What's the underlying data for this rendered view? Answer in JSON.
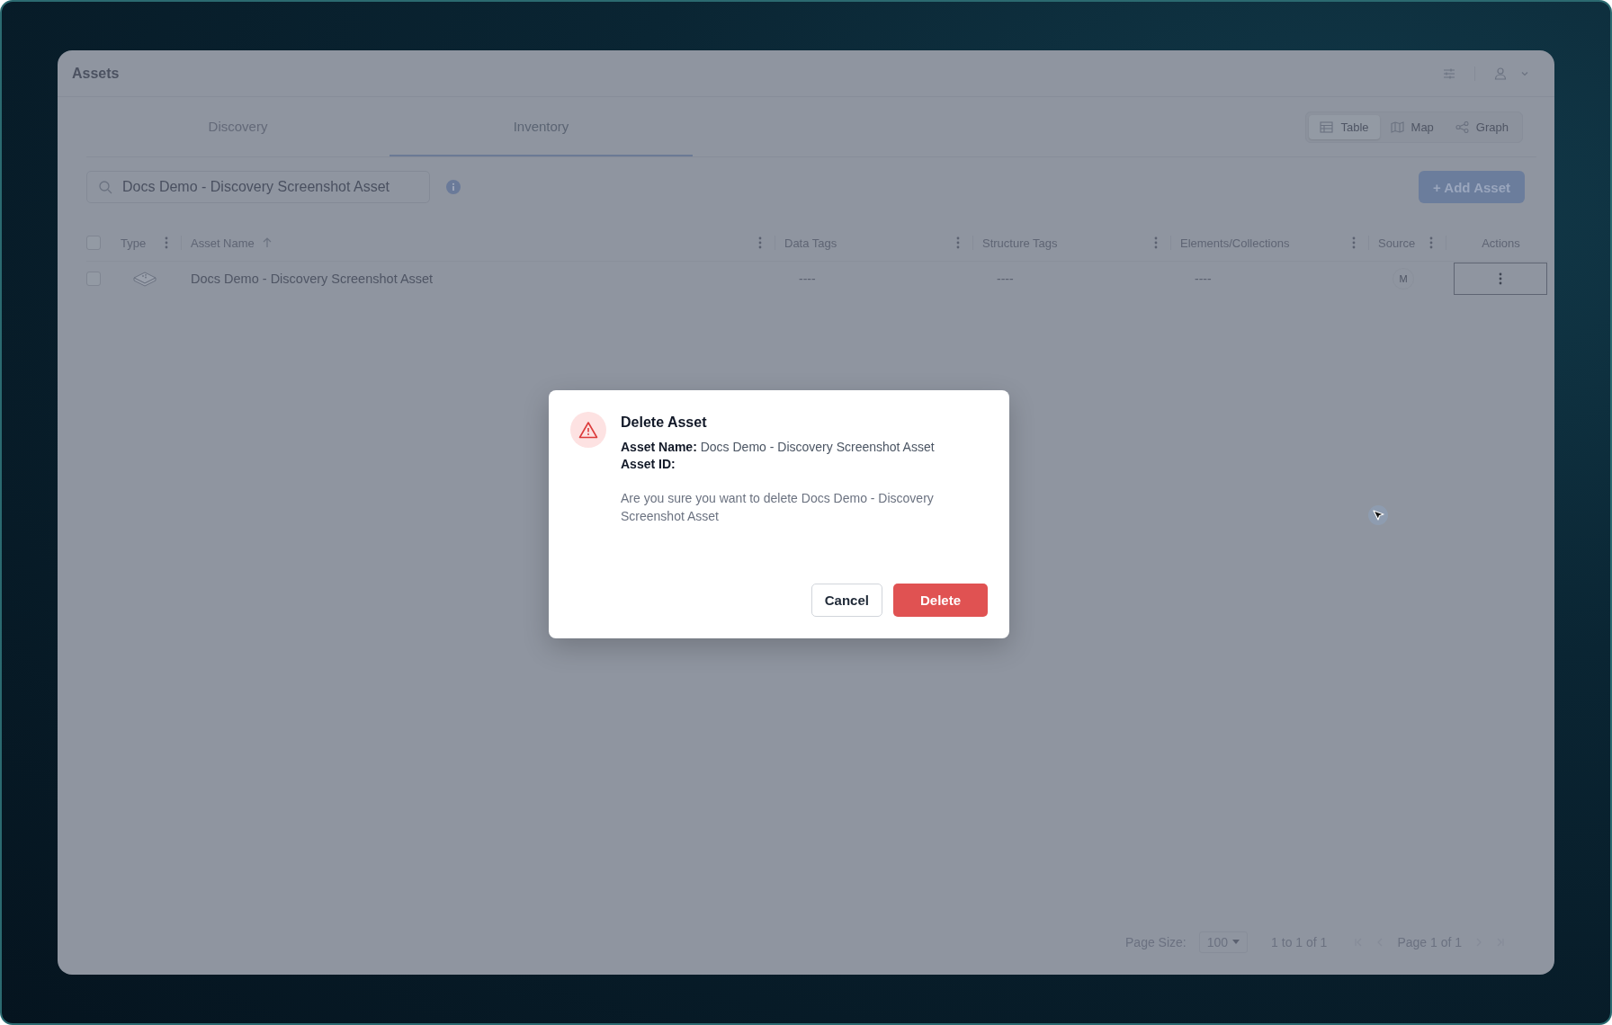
{
  "header": {
    "title": "Assets"
  },
  "tabs": [
    {
      "label": "Discovery",
      "selected": false
    },
    {
      "label": "Inventory",
      "selected": true
    }
  ],
  "view_switcher": [
    {
      "label": "Table",
      "kind": "table",
      "selected": true
    },
    {
      "label": "Map",
      "kind": "map",
      "selected": false
    },
    {
      "label": "Graph",
      "kind": "graph",
      "selected": false
    }
  ],
  "search": {
    "value": "Docs Demo - Discovery Screenshot Asset"
  },
  "add_button": "+ Add Asset",
  "table": {
    "select_all_checked": false,
    "columns": [
      {
        "label": "Type",
        "menu": true,
        "sorted": false
      },
      {
        "label": "Asset Name",
        "menu": true,
        "sorted": true
      },
      {
        "label": "Data Tags",
        "menu": true,
        "sorted": false
      },
      {
        "label": "Structure Tags",
        "menu": true,
        "sorted": false
      },
      {
        "label": "Elements/Collections",
        "menu": true,
        "sorted": false
      },
      {
        "label": "Source",
        "menu": true,
        "sorted": false
      },
      {
        "label": "Actions",
        "menu": false,
        "sorted": false
      }
    ],
    "rows": [
      {
        "checked": false,
        "name": "Docs Demo - Discovery Screenshot Asset",
        "data_tags": "----",
        "structure_tags": "----",
        "elements_collections": "----",
        "source": "M"
      }
    ]
  },
  "pagination": {
    "page_size_label": "Page Size:",
    "page_size": "100",
    "range": "1 to 1 of 1",
    "page": "Page 1 of 1"
  },
  "dialog": {
    "title": "Delete Asset",
    "name_label": "Asset Name:",
    "name_value": "Docs Demo - Discovery Screenshot Asset",
    "id_label": "Asset ID:",
    "message": "Are you sure you want to delete Docs Demo - Discovery Screenshot Asset",
    "buttons": [
      {
        "label": "Cancel",
        "kind": "secondary"
      },
      {
        "label": "Delete",
        "kind": "danger"
      }
    ]
  }
}
